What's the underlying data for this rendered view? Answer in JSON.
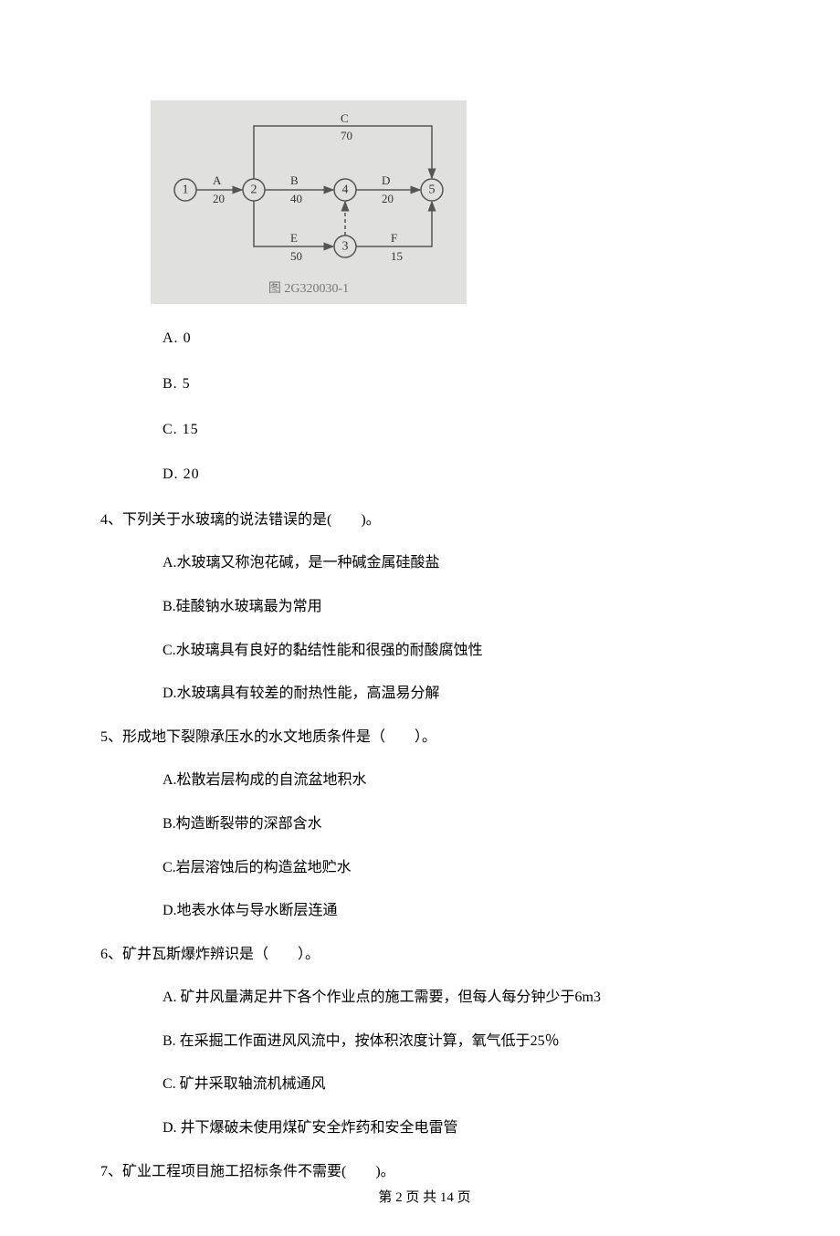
{
  "diagram": {
    "caption": "图 2G320030-1",
    "nodes": {
      "n1": "1",
      "n2": "2",
      "n3": "3",
      "n4": "4",
      "n5": "5"
    },
    "edges": {
      "A": {
        "label": "A",
        "weight": "20"
      },
      "B": {
        "label": "B",
        "weight": "40"
      },
      "C": {
        "label": "C",
        "weight": "70"
      },
      "D": {
        "label": "D",
        "weight": "20"
      },
      "E": {
        "label": "E",
        "weight": "50"
      },
      "F": {
        "label": "F",
        "weight": "15"
      }
    }
  },
  "q3": {
    "A": {
      "label": "A.",
      "text": "0"
    },
    "B": {
      "label": "B.",
      "text": "5"
    },
    "C": {
      "label": "C.",
      "text": "15"
    },
    "D": {
      "label": "D.",
      "text": "20"
    }
  },
  "q4": {
    "stem": "4、下列关于水玻璃的说法错误的是(　　)。",
    "A": "A.水玻璃又称泡花碱，是一种碱金属硅酸盐",
    "B": "B.硅酸钠水玻璃最为常用",
    "C": "C.水玻璃具有良好的黏结性能和很强的耐酸腐蚀性",
    "D": "D.水玻璃具有较差的耐热性能，高温易分解"
  },
  "q5": {
    "stem": "5、形成地下裂隙承压水的水文地质条件是（　　）。",
    "A": "A.松散岩层构成的自流盆地积水",
    "B": "B.构造断裂带的深部含水",
    "C": "C.岩层溶蚀后的构造盆地贮水",
    "D": "D.地表水体与导水断层连通"
  },
  "q6": {
    "stem": "6、矿井瓦斯爆炸辨识是（　　）。",
    "A": "A. 矿井风量满足井下各个作业点的施工需要，但每人每分钟少于6m3",
    "B": "B. 在采掘工作面进风风流中，按体积浓度计算，氧气低于25％",
    "C": "C. 矿井采取轴流机械通风",
    "D": "D. 井下爆破未使用煤矿安全炸药和安全电雷管"
  },
  "q7": {
    "stem": "7、矿业工程项目施工招标条件不需要(　　)。"
  },
  "footer": "第 2 页 共 14 页"
}
